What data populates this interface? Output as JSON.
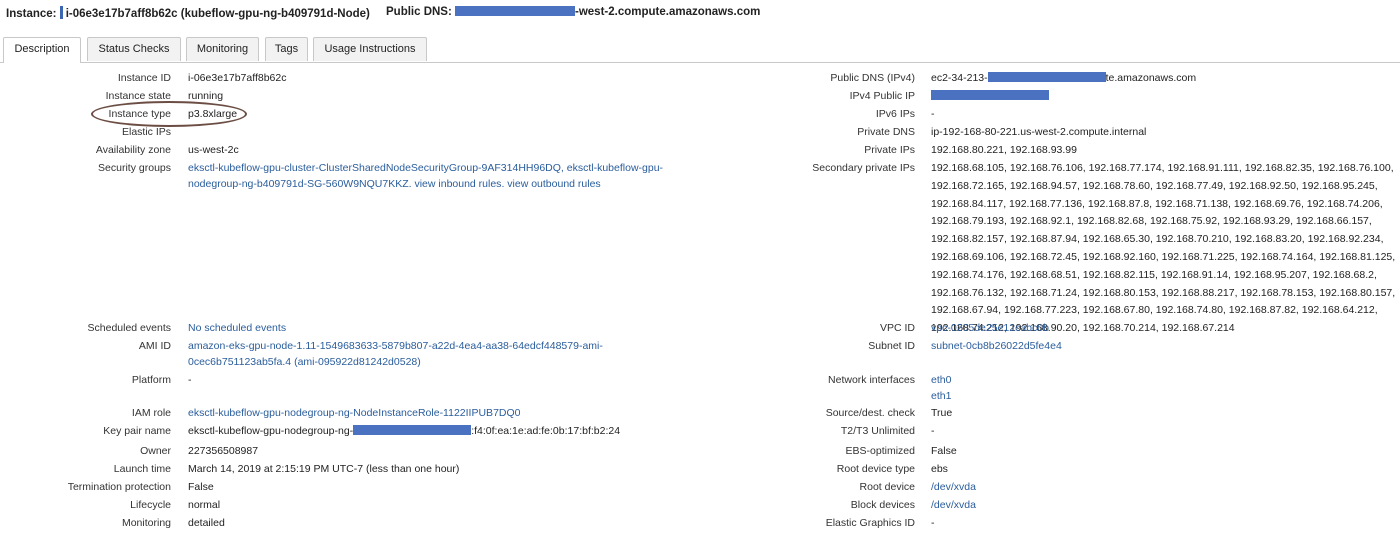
{
  "topbar": {
    "instance_label": "Instance:",
    "instance_value": "i-06e3e17b7aff8b62c (kubeflow-gpu-ng-b409791d-Node)",
    "dns_label": "Public DNS:",
    "dns_suffix": "-west-2.compute.amazonaws.com"
  },
  "tabs": [
    "Description",
    "Status Checks",
    "Monitoring",
    "Tags",
    "Usage Instructions"
  ],
  "left": {
    "instance_id": {
      "label": "Instance ID",
      "value": "i-06e3e17b7aff8b62c"
    },
    "instance_state": {
      "label": "Instance state",
      "value": "running"
    },
    "instance_type": {
      "label": "Instance type",
      "value": "p3.8xlarge"
    },
    "elastic_ips": {
      "label": "Elastic IPs",
      "value": ""
    },
    "availability_zone": {
      "label": "Availability zone",
      "value": "us-west-2c"
    },
    "security_groups": {
      "label": "Security groups",
      "line1": "eksctl-kubeflow-gpu-cluster-ClusterSharedNodeSecurityGroup-9AF314HH96DQ,",
      "line1b": "eksctl-kubeflow-gpu-",
      "line2a": "nodegroup-ng-b409791d-SG-560W9NQU7KKZ.",
      "inbound": "view inbound rules",
      "sep": ".",
      "outbound": "view outbound rules"
    },
    "scheduled_events": {
      "label": "Scheduled events",
      "value": "No scheduled events"
    },
    "ami_id": {
      "label": "AMI ID",
      "line1": "amazon-eks-gpu-node-1.11-1549683633-5879b807-a22d-4ea4-aa38-64edcf448579-ami-",
      "line2": "0cec6b751123ab5fa.4 (ami-095922d81242d0528)"
    },
    "platform": {
      "label": "Platform",
      "value": "-"
    },
    "iam_role": {
      "label": "IAM role",
      "value": "eksctl-kubeflow-gpu-nodegroup-ng-NodeInstanceRole-1122IIPUB7DQ0"
    },
    "key_pair": {
      "label": "Key pair name",
      "prefix": "eksctl-kubeflow-gpu-nodegroup-ng-",
      "suffix": ":f4:0f:ea:1e:ad:fe:0b:17:bf:b2:24"
    },
    "owner": {
      "label": "Owner",
      "value": "227356508987"
    },
    "launch_time": {
      "label": "Launch time",
      "value": "March 14, 2019 at 2:15:19 PM UTC-7 (less than one hour)"
    },
    "termination_protection": {
      "label": "Termination protection",
      "value": "False"
    },
    "lifecycle": {
      "label": "Lifecycle",
      "value": "normal"
    },
    "monitoring": {
      "label": "Monitoring",
      "value": "detailed"
    }
  },
  "right": {
    "public_dns": {
      "label": "Public DNS (IPv4)",
      "prefix": "ec2-34-213-",
      "suffix": "te.amazonaws.com"
    },
    "ipv4_public_ip": {
      "label": "IPv4 Public IP",
      "value": ""
    },
    "ipv6_ips": {
      "label": "IPv6 IPs",
      "value": "-"
    },
    "private_dns": {
      "label": "Private DNS",
      "value": "ip-192-168-80-221.us-west-2.compute.internal"
    },
    "private_ips": {
      "label": "Private IPs",
      "value": "192.168.80.221, 192.168.93.99"
    },
    "secondary_private_ips": {
      "label": "Secondary private IPs",
      "lines": [
        "192.168.68.105, 192.168.76.106, 192.168.77.174, 192.168.91.111, 192.168.82.35, 192.168.76.100,",
        "192.168.72.165, 192.168.94.57, 192.168.78.60, 192.168.77.49, 192.168.92.50, 192.168.95.245,",
        "192.168.84.117, 192.168.77.136, 192.168.87.8, 192.168.71.138, 192.168.69.76, 192.168.74.206,",
        "192.168.79.193, 192.168.92.1, 192.168.82.68, 192.168.75.92, 192.168.93.29, 192.168.66.157,",
        "192.168.82.157, 192.168.87.94, 192.168.65.30, 192.168.70.210, 192.168.83.20, 192.168.92.234,",
        "192.168.69.106, 192.168.72.45, 192.168.92.160, 192.168.71.225, 192.168.74.164, 192.168.81.125,",
        "192.168.74.176, 192.168.68.51, 192.168.82.115, 192.168.91.14, 192.168.95.207, 192.168.68.2,",
        "192.168.76.132, 192.168.71.24, 192.168.80.153, 192.168.88.217, 192.168.78.153, 192.168.80.157,",
        "192.168.67.94, 192.168.77.223, 192.168.67.80, 192.168.74.80, 192.168.87.82, 192.168.64.212,",
        "192.168.74.212, 192.168.90.20, 192.168.70.214, 192.168.67.214"
      ]
    },
    "vpc_id": {
      "label": "VPC ID",
      "value": "vpc-0205de25e12cabc0b"
    },
    "subnet_id": {
      "label": "Subnet ID",
      "value": "subnet-0cb8b26022d5fe4e4"
    },
    "network_interfaces": {
      "label": "Network interfaces",
      "values": [
        "eth0",
        "eth1"
      ]
    },
    "source_dest_check": {
      "label": "Source/dest. check",
      "value": "True"
    },
    "t2t3_unlimited": {
      "label": "T2/T3 Unlimited",
      "value": "-"
    },
    "ebs_optimized": {
      "label": "EBS-optimized",
      "value": "False"
    },
    "root_device_type": {
      "label": "Root device type",
      "value": "ebs"
    },
    "root_device": {
      "label": "Root device",
      "value": "/dev/xvda"
    },
    "block_devices": {
      "label": "Block devices",
      "value": "/dev/xvda"
    },
    "elastic_graphics_id": {
      "label": "Elastic Graphics ID",
      "value": "-"
    }
  }
}
